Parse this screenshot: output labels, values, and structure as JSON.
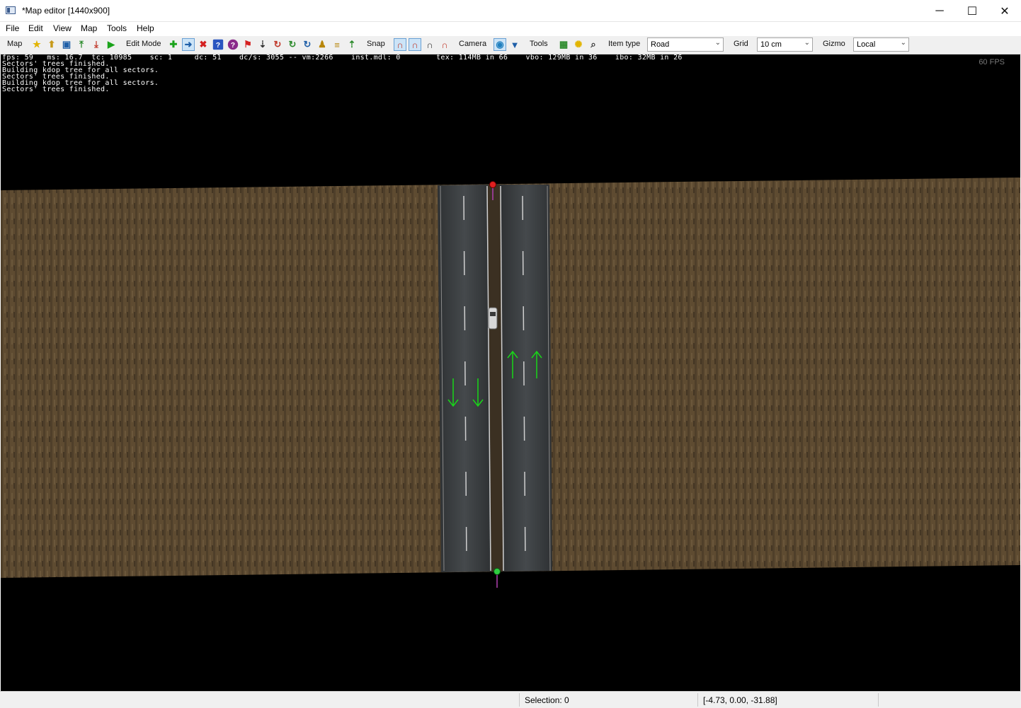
{
  "window": {
    "title": "*Map editor [1440x900]",
    "minimize_glyph": "─",
    "maximize_glyph": "☐",
    "close_glyph": "✕"
  },
  "menu": {
    "file": "File",
    "edit": "Edit",
    "view": "View",
    "map": "Map",
    "tools": "Tools",
    "help": "Help"
  },
  "toolbar": {
    "map_label": "Map",
    "edit_mode_label": "Edit Mode",
    "snap_label": "Snap",
    "camera_label": "Camera",
    "tools_label": "Tools",
    "item_type_label": "Item type",
    "item_type_value": "Road",
    "grid_label": "Grid",
    "grid_value": "10 cm",
    "gizmo_label": "Gizmo",
    "gizmo_value": "Local",
    "icons": {
      "favorite": "★",
      "open": "⬆",
      "save": "▣",
      "export": "⤒",
      "import": "⤓",
      "play": "▶",
      "add": "✚",
      "select_arrow": "➜",
      "delete": "✖",
      "help": "?",
      "info": "?",
      "flag": "⚑",
      "down": "⇣",
      "rotate_x": "↻",
      "rotate_y": "↻",
      "rotate_z": "↻",
      "person": "♟",
      "ruler": "≡",
      "up": "⇡",
      "magnet1": "∩",
      "magnet2": "∩",
      "magnet3": "∩",
      "magnet4": "∩",
      "globe": "◉",
      "funnel": "▼",
      "grid": "▦",
      "sun": "✺",
      "search": "⌕"
    }
  },
  "console": {
    "stats": "fps: 59   ms: 16.7  tc: 10985    sc: 1     dc: 51    dc/s: 3055 -- vm:2266    inst.mdl: 0        tex: 114MB in 66    vbo: 129MB in 36    ibo: 32MB in 26",
    "lines": [
      "Sectors' trees finished.",
      "Building kdop tree for all sectors.",
      "Sectors' trees finished.",
      "Building kdop tree for all sectors.",
      "Sectors' trees finished."
    ]
  },
  "viewport": {
    "fps_overlay": "60 FPS",
    "colors": {
      "terrain": "#6b5638",
      "road": "#3a3d40",
      "lane_arrow": "#19d619",
      "start_node": "#e02020",
      "end_node": "#2ecc40"
    }
  },
  "status": {
    "selection": "Selection: 0",
    "coordinates": "[-4.73, 0.00, -31.88]"
  }
}
